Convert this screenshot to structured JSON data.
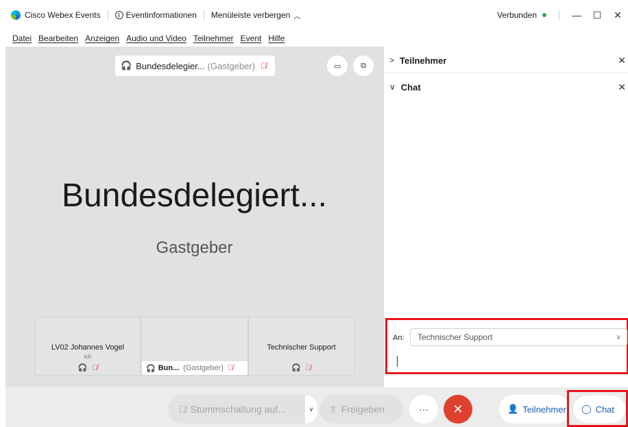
{
  "window": {
    "app_title": "Cisco Webex Events",
    "event_info": "Eventinformationen",
    "hide_menu": "Menüleiste verbergen",
    "status": "Verbunden",
    "minimize": "—",
    "maximize": "☐",
    "close": "✕"
  },
  "menu": [
    "Datei",
    "Bearbeiten",
    "Anzeigen",
    "Audio und Video",
    "Teilnehmer",
    "Event",
    "Hilfe"
  ],
  "stage": {
    "speaker_name": "Bundesdelegier...",
    "speaker_role": "(Gastgeber)",
    "big_name": "Bundesdelegiert...",
    "big_role": "Gastgeber"
  },
  "thumbnails": [
    {
      "name": "LV02 Johannes Vogel",
      "sub": "ich"
    },
    {
      "name": "Bun...",
      "role": "(Gastgeber)"
    },
    {
      "name": "Technischer Support"
    }
  ],
  "panel": {
    "participants_header": "Teilnehmer",
    "chat_header": "Chat",
    "to_label": "An:",
    "recipient": "Technischer Support"
  },
  "toolbar": {
    "mute_label": "Stummschaltung auf...",
    "share_label": "Freigeben",
    "more_label": "···",
    "leave_label": "✕",
    "participants_label": "Teilnehmer",
    "chat_label": "Chat"
  },
  "colors": {
    "highlight_red": "#e8141a",
    "leave_red": "#e0412f",
    "accent_blue": "#1b5fb5",
    "connected_green": "#2fa84f"
  }
}
